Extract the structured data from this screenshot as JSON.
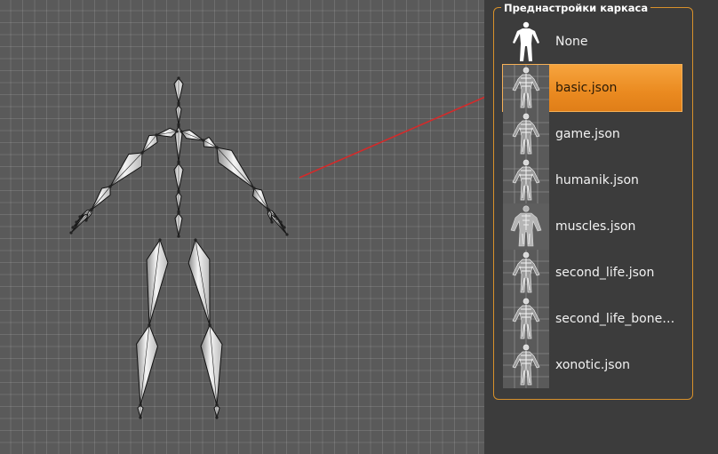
{
  "panel": {
    "title": "Преднастройки каркаса",
    "presets": [
      {
        "label": "None",
        "icon": "human-silhouette-icon",
        "selected": false
      },
      {
        "label": "basic.json",
        "icon": "skeleton-thumbnail",
        "selected": true
      },
      {
        "label": "game.json",
        "icon": "skeleton-thumbnail",
        "selected": false
      },
      {
        "label": "humanik.json",
        "icon": "skeleton-thumbnail",
        "selected": false
      },
      {
        "label": "muscles.json",
        "icon": "muscle-thumbnail",
        "selected": false
      },
      {
        "label": "second_life.json",
        "icon": "skeleton-thumbnail",
        "selected": false
      },
      {
        "label": "second_life_bones.j...",
        "icon": "skeleton-thumbnail",
        "selected": false
      },
      {
        "label": "xonotic.json",
        "icon": "skeleton-thumbnail",
        "selected": false
      }
    ]
  },
  "colors": {
    "accent": "#f0962f",
    "annotation_arrow": "#d42a2a",
    "viewport_bg": "#5a5a5a",
    "panel_bg": "#3c3c3c"
  }
}
